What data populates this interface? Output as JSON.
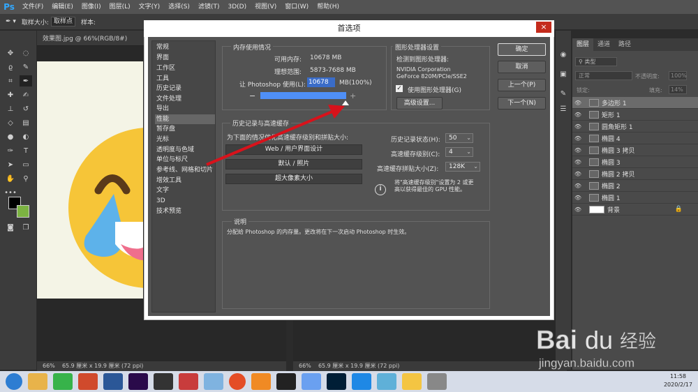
{
  "menubar": {
    "logo": "Ps",
    "items": [
      "文件(F)",
      "编辑(E)",
      "图像(I)",
      "图层(L)",
      "文字(Y)",
      "选择(S)",
      "滤镜(T)",
      "3D(D)",
      "视图(V)",
      "窗口(W)",
      "帮助(H)"
    ]
  },
  "options": {
    "sample_size_label": "取样大小:",
    "sample_size_value": "取样点",
    "sample_label": "样本:"
  },
  "document": {
    "left_tab": "效果图.jpg @ 66%(RGB/8#)",
    "left_zoom": "66%",
    "left_size": "65.9 厘米 x 19.9 厘米 (72 ppi)",
    "right_zoom": "66%",
    "right_size": "65.9 厘米 x 19.9 厘米 (72 ppi)"
  },
  "dialog": {
    "title": "首选项",
    "close": "×",
    "nav": [
      "常规",
      "界面",
      "工作区",
      "工具",
      "历史记录",
      "文件处理",
      "导出",
      "性能",
      "暂存盘",
      "光标",
      "透明度与色域",
      "单位与标尺",
      "参考线、网格和切片",
      "增效工具",
      "文字",
      "3D",
      "技术预览"
    ],
    "nav_selected_index": 7,
    "memory": {
      "legend": "内存使用情况",
      "available_label": "可用内存:",
      "available_value": "10678 MB",
      "ideal_label": "理想范围:",
      "ideal_value": "5873-7688 MB",
      "let_label": "让 Photoshop 使用(L):",
      "let_value": "10678",
      "let_suffix": "MB(100%)",
      "slider_fraction": 1.0,
      "minus": "−",
      "plus": "+"
    },
    "gpu": {
      "legend": "图形处理器设置",
      "detected_label": "检测到图形处理器:",
      "gpu_line1": "NVIDIA Corporation",
      "gpu_line2": "GeForce 820M/PCIe/SSE2",
      "use_gpu_label": "使用图形处理器(G)",
      "use_gpu_checked": true,
      "advanced_button": "高级设置..."
    },
    "history": {
      "legend": "历史记录与高速缓存",
      "intro": "为下面的情况优化高速缓存级别和拼贴大小:",
      "presets": [
        "Web / 用户界面设计",
        "默认 / 照片",
        "超大像素大小"
      ],
      "states_label": "历史记录状态(H):",
      "states_value": "50",
      "levels_label": "高速缓存级别(C):",
      "levels_value": "4",
      "tile_label": "高速缓存拼贴大小(Z):",
      "tile_value": "128K",
      "info_text_1": "将\"高速缓存级别\"设置为 2 或更",
      "info_text_2": "高以获得最佳的 GPU 性能。"
    },
    "description": {
      "legend": "说明",
      "text": "分配给 Photoshop 的内存量。更改将在下一次启动 Photoshop 时生效。"
    },
    "buttons": {
      "ok": "确定",
      "cancel": "取消",
      "prev": "上一个(P)",
      "next": "下一个(N)"
    }
  },
  "layers_panel": {
    "tabs": [
      "图层",
      "通道",
      "路径"
    ],
    "kind_label": "类型",
    "blend_mode": "正常",
    "opacity_label": "不透明度:",
    "opacity_value": "100%",
    "lock_label": "锁定:",
    "fill_label": "填充:",
    "fill_value": "14%",
    "layers": [
      "多边形 1",
      "矩形 1",
      "圆角矩形 1",
      "椭圆 4",
      "椭圆 3 拷贝",
      "椭圆 3",
      "椭圆 2 拷贝",
      "椭圆 2",
      "椭圆 1",
      "背景"
    ],
    "selected_index": 0
  },
  "watermark": {
    "brand": "Bai",
    "brand2": "经验",
    "url": "jingyan.baidu.com"
  },
  "taskbar": {
    "time": "11:58",
    "date": "2020/2/17"
  },
  "colors": {
    "accent_blue": "#4f8ff7",
    "ps_blue": "#31a8ff",
    "arrow_red": "#d8121b",
    "emoji_yellow": "#f6c538",
    "tear_blue": "#5db2ea"
  }
}
